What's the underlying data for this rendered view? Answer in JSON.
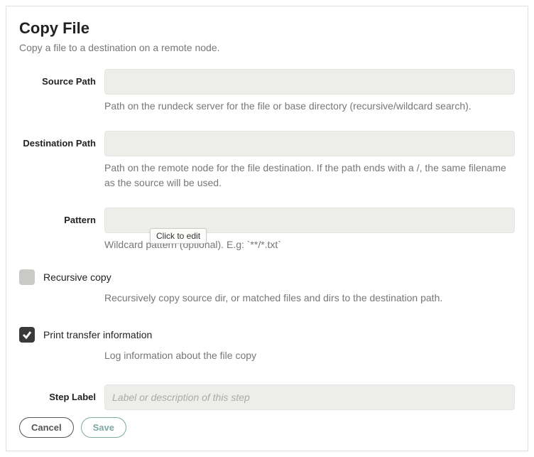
{
  "title": "Copy File",
  "subtitle": "Copy a file to a destination on a remote node.",
  "fields": {
    "source_path": {
      "label": "Source Path",
      "value": "",
      "help": "Path on the rundeck server for the file or base directory (recursive/wildcard search)."
    },
    "destination_path": {
      "label": "Destination Path",
      "value": "",
      "help": "Path on the remote node for the file destination. If the path ends with a /, the same filename as the source will be used."
    },
    "pattern": {
      "label": "Pattern",
      "value": "",
      "help": "Wildcard pattern (optional). E.g: `**/*.txt`"
    },
    "step_label": {
      "label": "Step Label",
      "placeholder": "Label or description of this step",
      "value": ""
    }
  },
  "checkboxes": {
    "recursive": {
      "label": "Recursive copy",
      "checked": false,
      "help": "Recursively copy source dir, or matched files and dirs to the destination path."
    },
    "print_info": {
      "label": "Print transfer information",
      "checked": true,
      "help": "Log information about the file copy"
    }
  },
  "buttons": {
    "cancel": "Cancel",
    "save": "Save"
  },
  "tooltip": "Click to edit"
}
